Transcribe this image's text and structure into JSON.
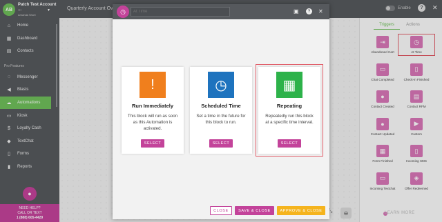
{
  "account": {
    "initials": "AB",
    "name": "Patch Test Account ...",
    "subname": "Amanda Short"
  },
  "sidebar": {
    "items": [
      {
        "label": "Home",
        "icon": "home-icon",
        "glyph": "⌂"
      },
      {
        "label": "Dashboard",
        "icon": "dashboard-icon",
        "glyph": "▦"
      },
      {
        "label": "Contacts",
        "icon": "contacts-icon",
        "glyph": "▤"
      }
    ],
    "section_label": "Pro Features",
    "pro_items": [
      {
        "label": "Messenger",
        "icon": "messenger-icon",
        "glyph": "◌"
      },
      {
        "label": "Blasts",
        "icon": "megaphone-icon",
        "glyph": "◀"
      },
      {
        "label": "Automations",
        "icon": "cloud-icon",
        "glyph": "☁",
        "active": true
      },
      {
        "label": "Kiosk",
        "icon": "kiosk-icon",
        "glyph": "▭"
      },
      {
        "label": "Loyalty Cash",
        "icon": "loyalty-cash-icon",
        "glyph": "$"
      },
      {
        "label": "TextChat",
        "icon": "textchat-icon",
        "glyph": "◆"
      },
      {
        "label": "Forms",
        "icon": "forms-icon",
        "glyph": "▯"
      },
      {
        "label": "Reports",
        "icon": "reports-icon",
        "glyph": "▮"
      }
    ],
    "help": {
      "line1": "NEED HELP?",
      "line2": "CALL OR TEXT",
      "phone": "1 (888) 605-4429"
    }
  },
  "topbar": {
    "title": "Quarterly Account Ove",
    "enable_label": "Enable",
    "help_glyph": "?",
    "close_glyph": "✕"
  },
  "modal": {
    "input_placeholder": "At Time",
    "cards": [
      {
        "title": "Run Immediately",
        "description": "This block will run as soon as this Automation is activated.",
        "button": "SELECT",
        "icon_color": "#f07f1d",
        "glyph": "!"
      },
      {
        "title": "Scheduled Time",
        "description": "Set a time in the future for this block to run.",
        "button": "SELECT",
        "icon_color": "#1e73be",
        "glyph": "◷"
      },
      {
        "title": "Repeating",
        "description": "Repeatedly run this block at a specific time interval.",
        "button": "SELECT",
        "icon_color": "#2db24a",
        "glyph": "▦"
      }
    ],
    "footer": {
      "close": "CLOSE",
      "save_close": "SAVE & CLOSE",
      "approve_close": "APPROVE & CLOSE"
    }
  },
  "rpanel": {
    "tabs": [
      "Triggers",
      "Actions"
    ],
    "triggers": [
      {
        "label": "Abandoned Cart",
        "glyph": "⇥"
      },
      {
        "label": "At Time",
        "glyph": "◷",
        "selected": true
      },
      {
        "label": "Chat Completed",
        "glyph": "▭"
      },
      {
        "label": "Check-in Finished",
        "glyph": "▯"
      },
      {
        "label": "Contact Created",
        "glyph": "●"
      },
      {
        "label": "Contact RFM",
        "glyph": "▤"
      },
      {
        "label": "Contact Updated",
        "glyph": "●"
      },
      {
        "label": "Custom",
        "glyph": "▶"
      },
      {
        "label": "Form Finished",
        "glyph": "▦"
      },
      {
        "label": "Incoming SMS",
        "glyph": "▯"
      },
      {
        "label": "Incoming Textchat",
        "glyph": "▭"
      },
      {
        "label": "Offer Redeemed",
        "glyph": "◈"
      }
    ],
    "learn_more": "LEARN MORE"
  }
}
